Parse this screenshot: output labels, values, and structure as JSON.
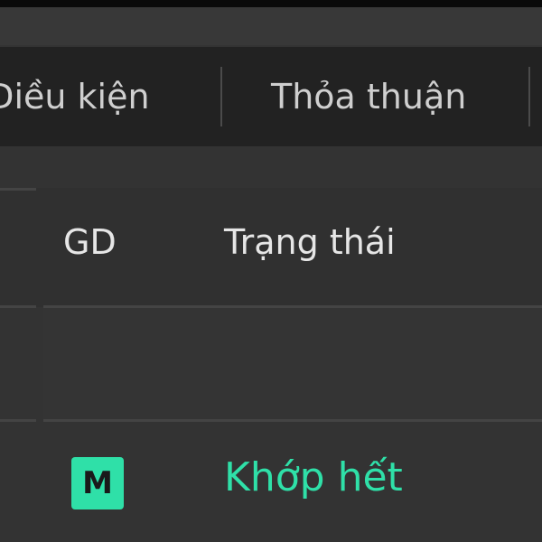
{
  "tabs": [
    {
      "label": "Điều kiện"
    },
    {
      "label": "Thỏa thuận"
    }
  ],
  "table": {
    "headers": {
      "gd": "GD",
      "status": "Trạng thái"
    },
    "rows": [
      {
        "badge": "M",
        "status": "Khớp hết"
      }
    ]
  },
  "colors": {
    "accent": "#2fe0a8",
    "background": "#333333",
    "tab_bar": "#222222"
  }
}
